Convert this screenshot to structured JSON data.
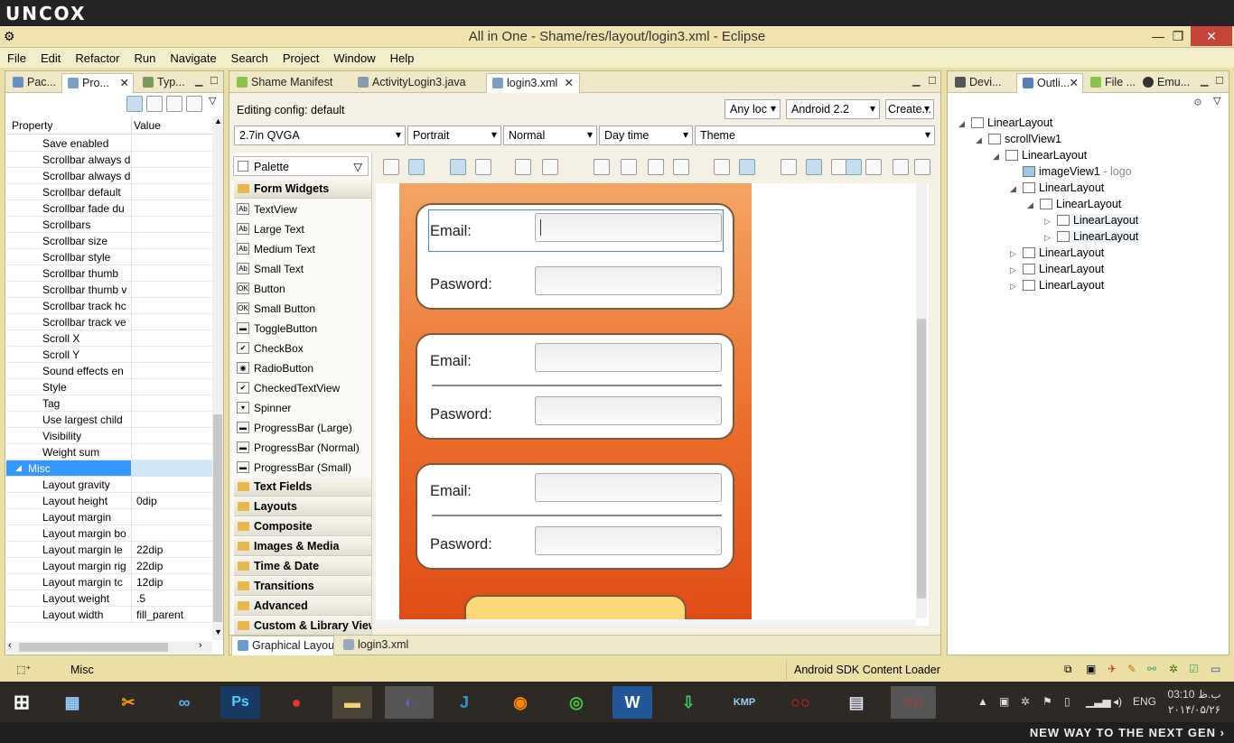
{
  "banner": {
    "brand": "UNCOX"
  },
  "window": {
    "title": "All in One - Shame/res/layout/login3.xml - Eclipse",
    "min": "—",
    "max": "❐",
    "close": "✕"
  },
  "menu": [
    "File",
    "Edit",
    "Refactor",
    "Run",
    "Navigate",
    "Search",
    "Project",
    "Window",
    "Help"
  ],
  "left_panel": {
    "tabs": [
      "Pac...",
      "Pro...",
      "Typ..."
    ],
    "header": {
      "property": "Property",
      "value": "Value"
    },
    "rows": [
      {
        "k": "Save enabled",
        "v": ""
      },
      {
        "k": "Scrollbar always d",
        "v": ""
      },
      {
        "k": "Scrollbar always d",
        "v": ""
      },
      {
        "k": "Scrollbar default",
        "v": ""
      },
      {
        "k": "Scrollbar fade du",
        "v": ""
      },
      {
        "k": "Scrollbars",
        "v": ""
      },
      {
        "k": "Scrollbar size",
        "v": ""
      },
      {
        "k": "Scrollbar style",
        "v": ""
      },
      {
        "k": "Scrollbar thumb",
        "v": ""
      },
      {
        "k": "Scrollbar thumb v",
        "v": ""
      },
      {
        "k": "Scrollbar track hc",
        "v": ""
      },
      {
        "k": "Scrollbar track ve",
        "v": ""
      },
      {
        "k": "Scroll X",
        "v": ""
      },
      {
        "k": "Scroll Y",
        "v": ""
      },
      {
        "k": "Sound effects en",
        "v": ""
      },
      {
        "k": "Style",
        "v": ""
      },
      {
        "k": "Tag",
        "v": ""
      },
      {
        "k": "Use largest child",
        "v": ""
      },
      {
        "k": "Visibility",
        "v": ""
      },
      {
        "k": "Weight sum",
        "v": ""
      },
      {
        "k": "Misc",
        "v": ""
      },
      {
        "k": "Layout gravity",
        "v": ""
      },
      {
        "k": "Layout height",
        "v": "0dip"
      },
      {
        "k": "Layout margin",
        "v": ""
      },
      {
        "k": "Layout margin bo",
        "v": ""
      },
      {
        "k": "Layout margin le",
        "v": "22dip"
      },
      {
        "k": "Layout margin rig",
        "v": "22dip"
      },
      {
        "k": "Layout margin tc",
        "v": "12dip"
      },
      {
        "k": "Layout weight",
        "v": ".5"
      },
      {
        "k": "Layout width",
        "v": "fill_parent"
      }
    ]
  },
  "editor": {
    "tabs": [
      "Shame Manifest",
      "ActivityLogin3.java",
      "login3.xml"
    ],
    "config_label": "Editing config:  default",
    "locale": "Any loc",
    "api": "Android 2.2",
    "create": "Create...",
    "device": "2.7in QVGA",
    "orientation": "Portrait",
    "mode": "Normal",
    "time": "Day time",
    "theme": "Theme",
    "palette_title": "Palette",
    "palette_categories": [
      "Form Widgets",
      "Text Fields",
      "Layouts",
      "Composite",
      "Images & Media",
      "Time & Date",
      "Transitions",
      "Advanced",
      "Custom & Library View"
    ],
    "palette_items": [
      {
        "icon": "Ab",
        "label": "TextView"
      },
      {
        "icon": "Ab",
        "label": "Large Text"
      },
      {
        "icon": "Ab",
        "label": "Medium Text"
      },
      {
        "icon": "Ab",
        "label": "Small Text"
      },
      {
        "icon": "OK",
        "label": "Button"
      },
      {
        "icon": "OK",
        "label": "Small Button"
      },
      {
        "icon": "▬",
        "label": "ToggleButton"
      },
      {
        "icon": "✔",
        "label": "CheckBox"
      },
      {
        "icon": "◉",
        "label": "RadioButton"
      },
      {
        "icon": "✔",
        "label": "CheckedTextView"
      },
      {
        "icon": "▾",
        "label": "Spinner"
      },
      {
        "icon": "▬",
        "label": "ProgressBar (Large)"
      },
      {
        "icon": "▬",
        "label": "ProgressBar (Normal)"
      },
      {
        "icon": "▬",
        "label": "ProgressBar (Small)"
      }
    ],
    "form": {
      "email": "Email:",
      "password": "Pasword:"
    },
    "bottom_tabs": [
      "Graphical Layout",
      "login3.xml"
    ]
  },
  "right_panel": {
    "tabs": [
      "Devi...",
      "Outli...",
      "File ...",
      "Emu..."
    ],
    "tree": [
      {
        "label": "LinearLayout",
        "level": 0,
        "expand": "open"
      },
      {
        "label": "scrollView1",
        "level": 1,
        "expand": "open"
      },
      {
        "label": "LinearLayout",
        "level": 2,
        "expand": "open"
      },
      {
        "label": "imageView1",
        "suffix": " - logo",
        "level": 3,
        "expand": ""
      },
      {
        "label": "LinearLayout",
        "level": 3,
        "expand": "open"
      },
      {
        "label": "LinearLayout",
        "level": 4,
        "expand": "open"
      },
      {
        "label": "LinearLayout",
        "level": 5,
        "expand": "closed"
      },
      {
        "label": "LinearLayout",
        "level": 5,
        "expand": "closed"
      },
      {
        "label": "LinearLayout",
        "level": 3,
        "expand": "closed"
      },
      {
        "label": "LinearLayout",
        "level": 3,
        "expand": "closed"
      },
      {
        "label": "LinearLayout",
        "level": 3,
        "expand": "closed"
      }
    ]
  },
  "status": {
    "left": "Misc",
    "center": "Android SDK Content Loader"
  },
  "taskbar": {
    "lang": "ENG",
    "time": "03:10 ب.ظ",
    "date": "۲۰۱۴/۰۵/۲۶"
  },
  "footer": {
    "slogan": "NEW WAY TO THE NEXT GEN ›"
  }
}
